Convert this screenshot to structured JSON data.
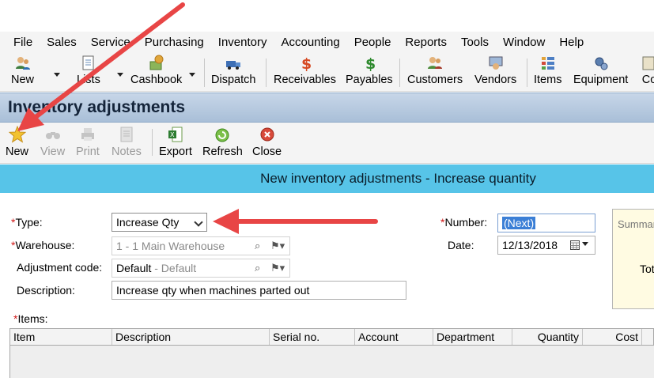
{
  "menu": [
    "File",
    "Sales",
    "Service",
    "Purchasing",
    "Inventory",
    "Accounting",
    "People",
    "Reports",
    "Tools",
    "Window",
    "Help"
  ],
  "toolbar": {
    "new": "New",
    "lists": "Lists",
    "cashbook": "Cashbook",
    "dispatch": "Dispatch",
    "receivables": "Receivables",
    "payables": "Payables",
    "customers": "Customers",
    "vendors": "Vendors",
    "items": "Items",
    "equipment": "Equipment",
    "contacts": "Co"
  },
  "window": {
    "title": "Inventory adjustments"
  },
  "actions": {
    "new": "New",
    "view": "View",
    "print": "Print",
    "notes": "Notes",
    "export": "Export",
    "refresh": "Refresh",
    "close": "Close"
  },
  "banner": "New inventory adjustments - Increase quantity",
  "form": {
    "required_mark": "*",
    "type_label": "Type:",
    "type_value": "Increase Qty",
    "warehouse_label": "Warehouse:",
    "warehouse_code": "1",
    "warehouse_name": " - 1 Main Warehouse",
    "adjustment_label": "Adjustment code:",
    "adjustment_code": "Default",
    "adjustment_name": " - Default",
    "description_label": "Description:",
    "description_value": "Increase qty when machines parted out",
    "number_label": "Number:",
    "number_value": "(Next)",
    "date_label": "Date:",
    "date_value": "12/13/2018",
    "items_label": "Items:"
  },
  "summary": {
    "title": "Summar",
    "total": "Tot"
  },
  "grid": {
    "columns": [
      "Item",
      "Description",
      "Serial no.",
      "Account",
      "Department",
      "Quantity",
      "Cost"
    ]
  },
  "colors": {
    "banner": "#57c4e8",
    "title_bar": "#b7c9de",
    "annotation_arrow": "#e84545",
    "summary_bg": "#fffbe2"
  }
}
